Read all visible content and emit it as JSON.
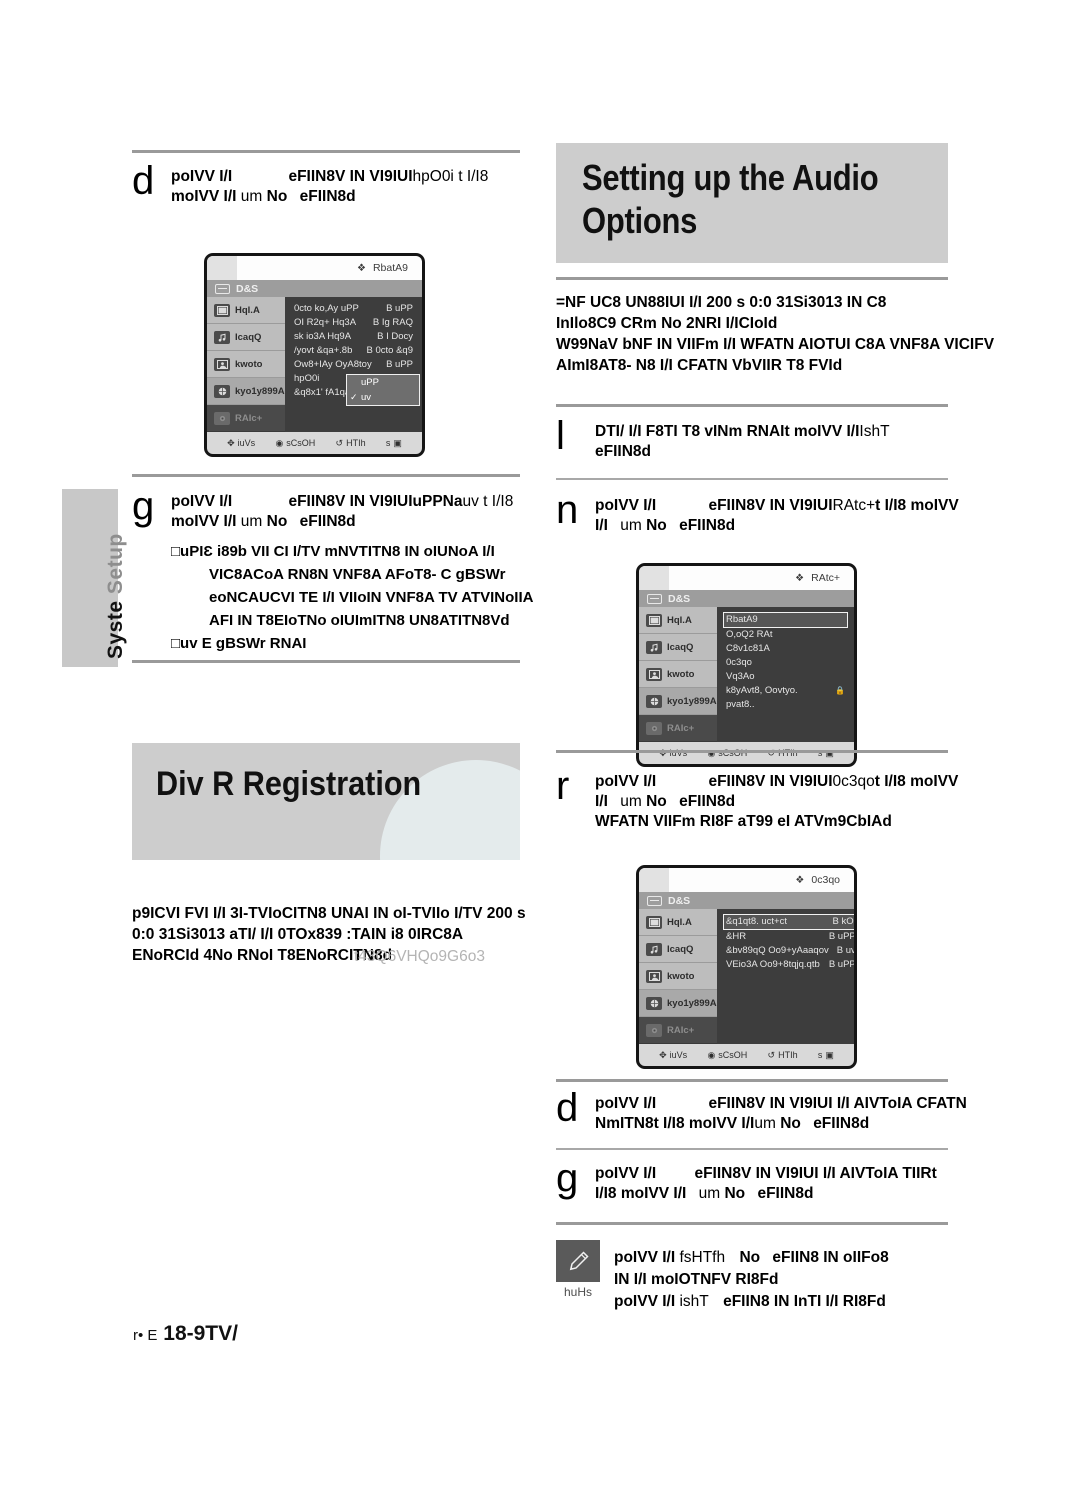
{
  "side_tab": {
    "word1": "Syste",
    "word2": "Setup"
  },
  "headings": {
    "audio": "Setting up the Audio\nOptions",
    "divx": "Div   R  Registration"
  },
  "left_column": {
    "step_d": {
      "mark": "d",
      "line1_a": "poIVV I/I",
      "line1_b": "eFIIN8V IN VI9IUI",
      "line1_c": "hpO0i",
      "line1_d": "t I/I8",
      "line2_a": "moIVV I/I",
      "line2_b": "um",
      "line2_c": "No",
      "line2_d": "eFIIN8d"
    },
    "step_g": {
      "mark": "g",
      "line1_a": "poIVV I/I",
      "line1_b": "eFIIN8V IN VI9IUI",
      "line1_c": "uPPNa",
      "line1_d": "uv  t I/I8",
      "line2_a": "moIVV I/I",
      "line2_b": "um",
      "line2_c": "No",
      "line2_d": "eFIIN8d",
      "subs": [
        "□uPIƐ i89b VII CI I/TV mNVTITN8 IN oIUNoA I/I",
        "VIC8ACoA RN8N VNF8A AFoT8- C gBSWr",
        "eoNCAUCVI TE I/I VIIoIN VNF8A TV ATVINoIIA",
        "AFI IN T8EIoTNo oIUImITN8 UN8ATITN8Vd",
        "□uv E gBSWr RNAI"
      ]
    },
    "divx_para": [
      "p9ICVI FVI I/I 3I-TVIoCITN8 UNAI IN oI-TVIIo I/TV 200 s",
      "0:0 31Si3013 aTI/ I/I 0TOx839 :TAIN i8 0IRC8A",
      "ENoRCId 4No RNoI T8ENoRCITN8d"
    ],
    "divx_para_faint": "t43Q6VHQo9G6o3"
  },
  "right_column": {
    "audio_para": [
      "=NF UC8 UN88IUI I/I 200 s 0:0 31Si3013 IN C8",
      "InIlo8C9 CRm No 2NRI I/ICIoId",
      "W99NaV bNF IN VIIFm I/I WFATN AIOTUI C8A VNF8A VICIFV",
      "AImI8AT8- N8 I/I CFATN VbVIIR T8 FVId"
    ],
    "step_l": {
      "mark": "l",
      "line1_a": "DTI/ I/I F8TI T8 vINm RNAIt moIVV I/I",
      "line1_b": "IshT",
      "line2": "eFIIN8d"
    },
    "step_n": {
      "mark": "n",
      "line1_a": "poIVV I/I",
      "line1_b": "eFIIN8V IN VI9IUI",
      "line1_c": "RAtc+",
      "line1_d": "t I/I8 moIVV",
      "line2_a": "I/I",
      "line2_b": "um",
      "line2_c": "No",
      "line2_d": "eFIIN8d"
    },
    "step_r": {
      "mark": "r",
      "line1_a": "poIVV I/I",
      "line1_b": "eFIIN8V IN VI9IUI",
      "line1_c": "0c3qo",
      "line1_d": "t I/I8 moIVV",
      "line2_a": "I/I",
      "line2_b": "um",
      "line2_c": "No",
      "line2_d": "eFIIN8d",
      "line3": "WFATN VIIFm RI8F aT99 eI ATVm9CbIAd"
    },
    "step_d2": {
      "mark": "d",
      "line1_a": "poIVV I/I",
      "line1_b": "eFIIN8V IN VI9IUI I/I AIVToIA CFATN",
      "line2_a": "NmITN8t I/I8 moIVV I/I",
      "line2_b": "um",
      "line2_c": "No",
      "line2_d": "eFIIN8d"
    },
    "step_g2": {
      "mark": "g",
      "line1_a": "poIVV I/I",
      "line1_b": "eFIIN8V IN VI9IUI I/I AIVToIA TIIRt",
      "line2_a": "I/I8 moIVV I/I",
      "line2_b": "um",
      "line2_c": "No",
      "line2_d": "eFIIN8d"
    }
  },
  "note": {
    "icon_label": "huHs",
    "line1_a": "poIVV I/I",
    "line1_b": "fsHTfh",
    "line1_c": "No",
    "line1_d": "eFIIN8 IN oIIFo8",
    "line2": "IN I/I moIOTNFV RI8Fd",
    "line3_a": "poIVV I/I",
    "line3_b": "ishT",
    "line3_c": "eFIIN8 IN InTI I/I RI8Fd"
  },
  "footer": {
    "prefix": "r• E",
    "page": "18-9TV/"
  },
  "osd_common": {
    "tab_label": "D&S",
    "side_items": [
      {
        "label": "HqI.A",
        "icon": "film-icon"
      },
      {
        "label": "IcaqQ",
        "icon": "music-note-icon"
      },
      {
        "label": "kwoto",
        "icon": "portrait-icon"
      },
      {
        "label": "kyo1y899A",
        "icon": "globe-icon"
      },
      {
        "label": "RAIc+",
        "icon": "gear-icon"
      }
    ],
    "hints": [
      {
        "icon": "✥",
        "label": "iuVs"
      },
      {
        "icon": "◉",
        "label": "sCsOH"
      },
      {
        "icon": "↺",
        "label": "HTIh"
      },
      {
        "icon": "▣",
        "label": "s"
      }
    ]
  },
  "osd1": {
    "title": "RbatA9",
    "rows": [
      {
        "k": "0cto ko,Ay uPP",
        "v": "B uPP"
      },
      {
        "k": "OI R2q+ Hq3A",
        "v": "B Ig RAQ"
      },
      {
        "k": "sk io3A Hq9A",
        "v": "B I Docy"
      },
      {
        "k": "/yovt &qa+.8b",
        "v": "B 0cto &q9"
      },
      {
        "k": "Ow8+IAy OyA8toy",
        "v": "B uPP"
      },
      {
        "k": "hpO0i",
        "v": "B"
      },
      {
        "k": "&q8x1' fA1qaty8tqo",
        "v": ""
      }
    ],
    "dropdown": [
      {
        "label": "uPP",
        "checked": false
      },
      {
        "label": "uv",
        "checked": true
      }
    ]
  },
  "osd2": {
    "title": "RAtc+",
    "rows": [
      {
        "k": "RbatA9",
        "sel": true
      },
      {
        "k": "O,oQ2 RAt"
      },
      {
        "k": "C8v1c81A"
      },
      {
        "k": "0c3qo"
      },
      {
        "k": "Vq3Ao"
      },
      {
        "k": "k8yAvt8, Oovtyo.",
        "lock": true
      },
      {
        "k": "pvat8.."
      }
    ]
  },
  "osd3": {
    "title": "0c3qo",
    "rows": [
      {
        "k": "&q1qt8. uct+ct",
        "v": "B kOi",
        "sel": true
      },
      {
        "k": "&HR",
        "v": "B uPP"
      },
      {
        "k": "&bv89qQ Oo9+yAaaqov",
        "v": "B uv"
      },
      {
        "k": "VEio3A Oo9+8tqjq.qtb",
        "v": "B uPP"
      }
    ]
  }
}
